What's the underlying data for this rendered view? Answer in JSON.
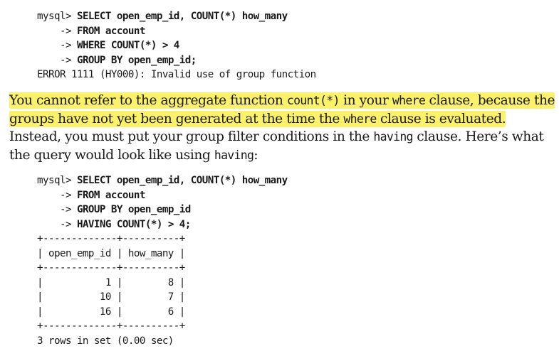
{
  "code_block_1": {
    "lines": [
      {
        "prompt": "mysql> ",
        "sql": "SELECT open_emp_id, COUNT(*) how_many"
      },
      {
        "prompt": "    -> ",
        "sql": "FROM account"
      },
      {
        "prompt": "    -> ",
        "sql": "WHERE COUNT(*) > 4"
      },
      {
        "prompt": "    -> ",
        "sql": "GROUP BY open_emp_id;"
      }
    ],
    "error": "ERROR 1111 (HY000): Invalid use of group function"
  },
  "paragraph": {
    "hl_1": "You cannot refer to the aggregate function ",
    "code_count": "count(*)",
    "hl_2": " in your ",
    "code_where_1": "where",
    "hl_3": " clause, because the groups have not yet been generated at the time the ",
    "code_where_2": "where",
    "hl_4": " clause is evaluated.",
    "text_1": " Instead, you must put your group filter conditions in the ",
    "code_having_1": "having",
    "text_2": " clause. Here’s what the query would look like using ",
    "code_having_2": "having",
    "text_3": ":"
  },
  "code_block_2": {
    "lines": [
      {
        "prompt": "mysql> ",
        "sql": "SELECT open_emp_id, COUNT(*) how_many"
      },
      {
        "prompt": "    -> ",
        "sql": "FROM account"
      },
      {
        "prompt": "    -> ",
        "sql": "GROUP BY open_emp_id"
      },
      {
        "prompt": "    -> ",
        "sql": "HAVING COUNT(*) > 4;"
      }
    ],
    "result_border": "+-------------+----------+",
    "result_header": "| open_emp_id | how_many |",
    "result_rows": [
      "|           1 |        8 |",
      "|          10 |        7 |",
      "|          16 |        6 |"
    ],
    "footer": "3 rows in set (0.00 sec)"
  }
}
